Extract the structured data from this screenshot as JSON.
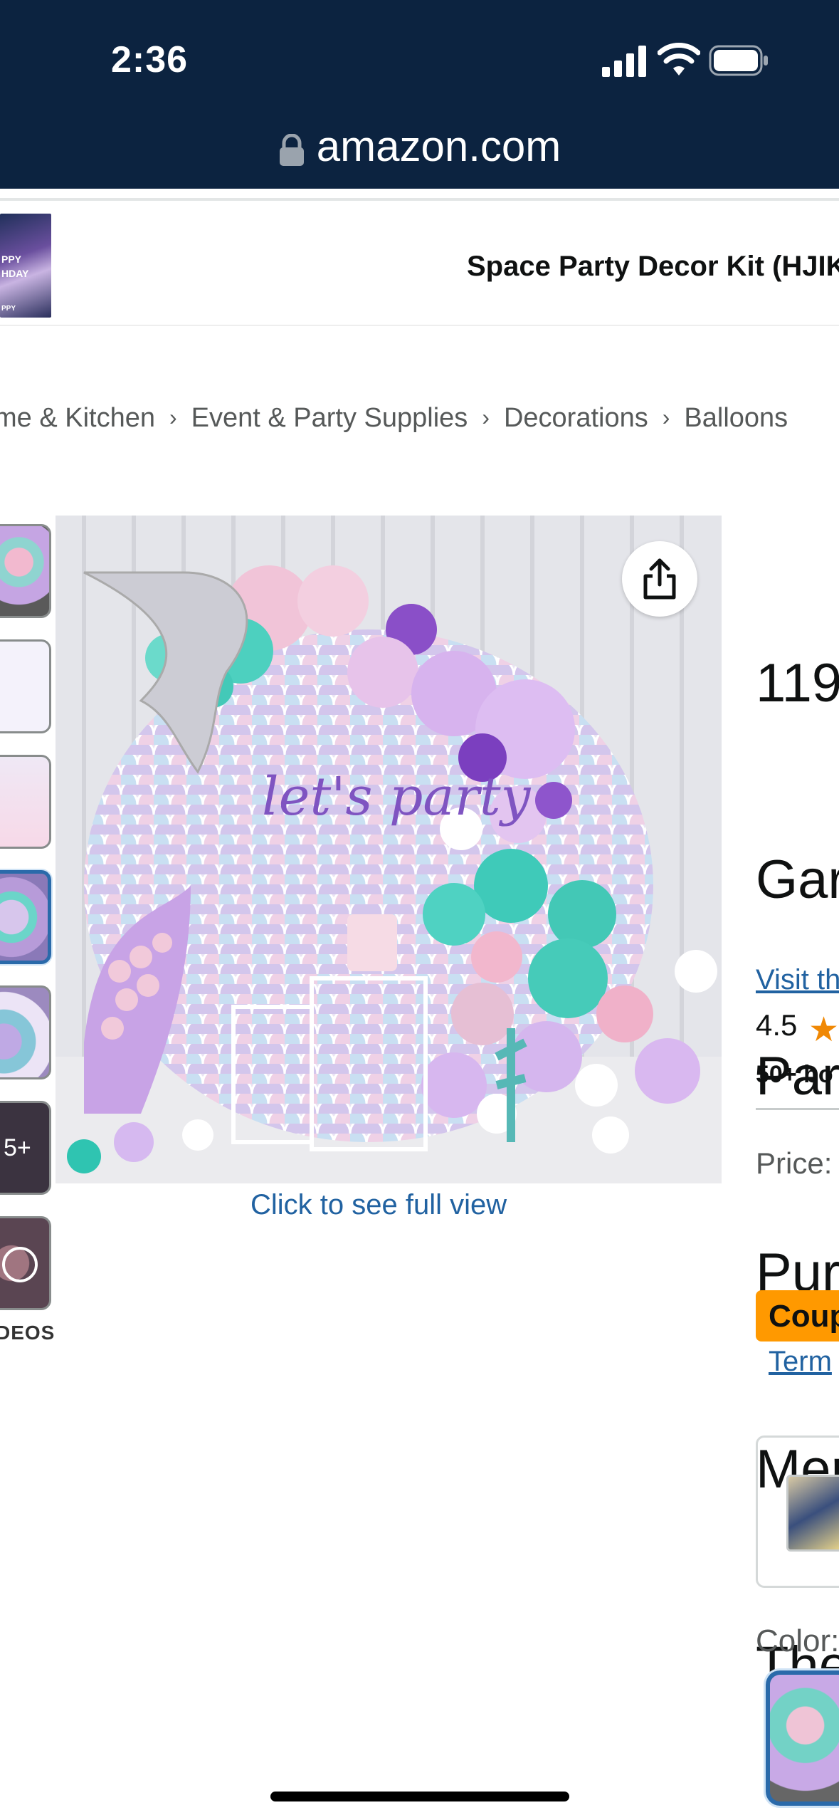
{
  "status_bar": {
    "time": "2:36"
  },
  "browser": {
    "url": "amazon.com"
  },
  "sticky_header": {
    "title": "Space Party Decor Kit (HJIK",
    "thumb_text": [
      "PPY",
      "HDAY",
      "PPY"
    ]
  },
  "breadcrumb": [
    "me & Kitchen",
    "Event & Party Supplies",
    "Decorations",
    "Balloons"
  ],
  "breadcrumb_separator": "›",
  "gallery": {
    "more_label": "5+",
    "videos_label": "DEOS",
    "image_caption": "let's party",
    "full_view_link": "Click to see full view"
  },
  "product": {
    "title_lines": [
      "119",
      "Gar",
      "Par",
      "Pur",
      "Mer",
      "The"
    ],
    "store_link": "Visit th",
    "rating": "4.5",
    "bought": "50+ bo",
    "price_label": "Price:",
    "coupon_label": "Coup",
    "terms_link": "Term",
    "color_label": "Color:"
  },
  "colors": {
    "status_bg": "#0c2340",
    "link": "#2162a1",
    "coupon": "#ff9900",
    "star": "#f08804",
    "selected_border": "#2a6aaa"
  }
}
